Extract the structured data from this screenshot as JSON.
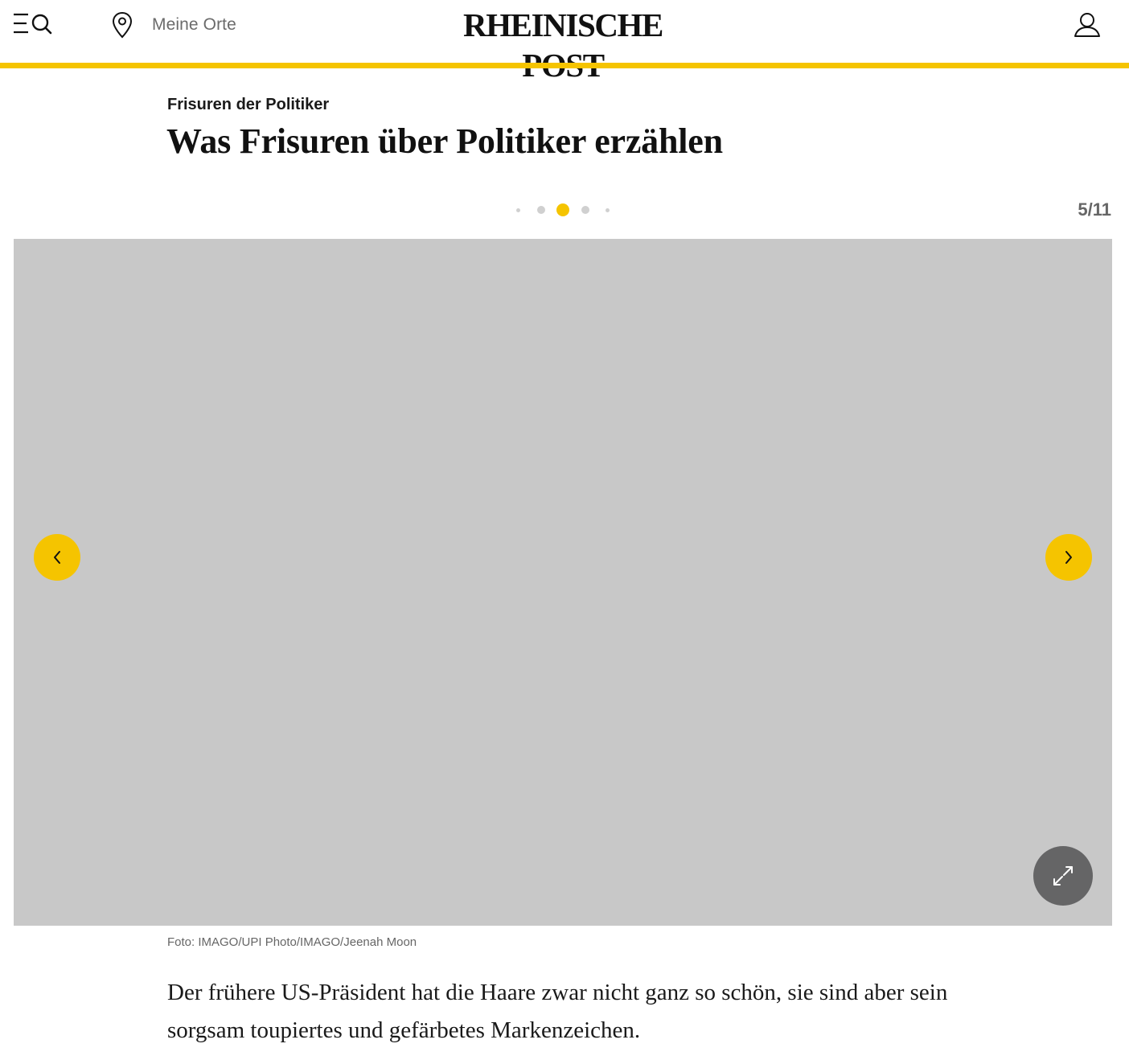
{
  "header": {
    "logo": "RHEINISCHE POST",
    "location_label": "Meine Orte",
    "icons": {
      "menu_search": "menu-search-icon",
      "location": "map-pin-icon",
      "account": "user-icon"
    },
    "accent_color": "#f5c400"
  },
  "article": {
    "kicker": "Frisuren der Politiker",
    "title": "Was Frisuren über Politiker erzählen"
  },
  "gallery": {
    "counter": "5/11",
    "current": 5,
    "total": 11,
    "image_credit": "Foto: IMAGO/UPI Photo/IMAGO/Jeenah Moon",
    "caption": "Der frühere US-Präsident hat die Haare zwar nicht ganz so schön, sie sind aber sein sorgsam toupiertes und gefärbetes Markenzeichen.",
    "controls": {
      "prev": "chevron-left-icon",
      "next": "chevron-right-icon",
      "expand": "expand-icon"
    }
  }
}
